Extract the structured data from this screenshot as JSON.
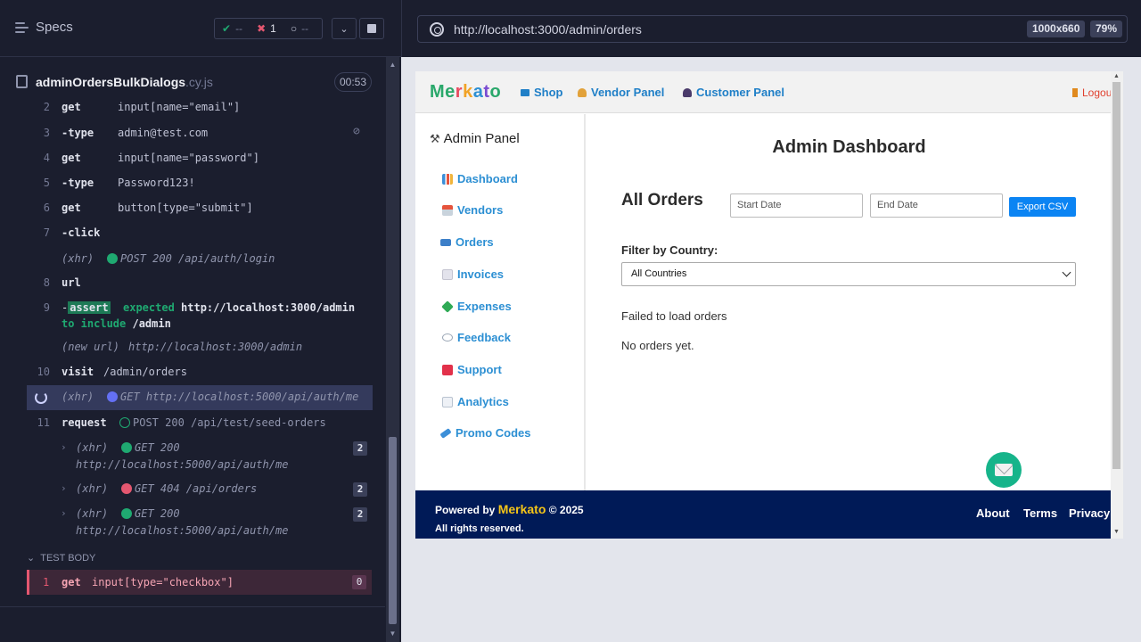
{
  "runner": {
    "specs_label": "Specs",
    "stats": {
      "passed": "--",
      "failed": "1",
      "pending": "--"
    },
    "spec_name": "adminOrdersBulkDialogs",
    "spec_ext": ".cy.js",
    "timer": "00:53",
    "commands": [
      {
        "num": "2",
        "name": "get",
        "msg": "input[name=\"email\"]"
      },
      {
        "num": "3",
        "name": "-type",
        "msg": "admin@test.com"
      },
      {
        "num": "4",
        "name": "get",
        "msg": "input[name=\"password\"]"
      },
      {
        "num": "5",
        "name": "-type",
        "msg": "Password123!"
      },
      {
        "num": "6",
        "name": "get",
        "msg": "button[type=\"submit\"]"
      },
      {
        "num": "7",
        "name": "-click",
        "msg": ""
      }
    ],
    "xhr_login": {
      "label": "(xhr)",
      "method": "POST 200 /api/auth/login"
    },
    "url_cmd": {
      "num": "8",
      "name": "url"
    },
    "assert_cmd": {
      "num": "9",
      "tag": "assert",
      "expected": "expected",
      "url": "http://localhost:3000/admin",
      "to_include": "to include",
      "value": "/admin"
    },
    "new_url": {
      "label": "(new url)",
      "url": "http://localhost:3000/admin"
    },
    "visit_cmd": {
      "num": "10",
      "name": "visit",
      "msg": "/admin/orders"
    },
    "pending_xhr": {
      "label": "(xhr)",
      "msg": "GET http://localhost:5000/api/auth/me"
    },
    "request_cmd": {
      "num": "11",
      "name": "request",
      "msg": "POST 200 /api/test/seed-orders"
    },
    "xhr_groups": [
      {
        "label": "(xhr)",
        "line1": "GET 200",
        "line2": "http://localhost:5000/api/auth/me",
        "count": "2",
        "status": "green"
      },
      {
        "label": "(xhr)",
        "line1": "GET 404 /api/orders",
        "line2": "",
        "count": "2",
        "status": "red"
      },
      {
        "label": "(xhr)",
        "line1": "GET 200",
        "line2": "http://localhost:5000/api/auth/me",
        "count": "2",
        "status": "green"
      }
    ],
    "test_body_label": "TEST BODY",
    "failed_cmd": {
      "num": "1",
      "name": "get",
      "msg": "input[type=\"checkbox\"]",
      "count": "0"
    }
  },
  "browser": {
    "url": "http://localhost:3000/admin/orders",
    "viewport": "1000x660",
    "zoom": "79%"
  },
  "site": {
    "logo": [
      "M",
      "e",
      "r",
      "k",
      "a",
      "t",
      "o"
    ],
    "logo_colors": [
      "#2aa86b",
      "#2aa86b",
      "#e84a5f",
      "#f1a326",
      "#2c8fd3",
      "#7a4bd1",
      "#2aa86b"
    ],
    "nav": [
      "Shop",
      "Vendor Panel",
      "Customer Panel"
    ],
    "logout": "Logout",
    "sidebar_title": "Admin Panel",
    "sidebar_items": [
      "Dashboard",
      "Vendors",
      "Orders",
      "Invoices",
      "Expenses",
      "Feedback",
      "Support",
      "Analytics",
      "Promo Codes"
    ],
    "dashboard_title": "Admin Dashboard",
    "orders_title": "All Orders",
    "start_date_placeholder": "Start Date",
    "end_date_placeholder": "End Date",
    "export_label": "Export CSV",
    "filter_label": "Filter by Country:",
    "country_selected": "All Countries",
    "error_msg": "Failed to load orders",
    "empty_msg": "No orders yet.",
    "footer": {
      "powered_by": "Powered by",
      "brand": "Merkato",
      "copyright": "© 2025",
      "rights": "All rights reserved.",
      "links": [
        "About",
        "Terms",
        "Privacy"
      ]
    }
  }
}
